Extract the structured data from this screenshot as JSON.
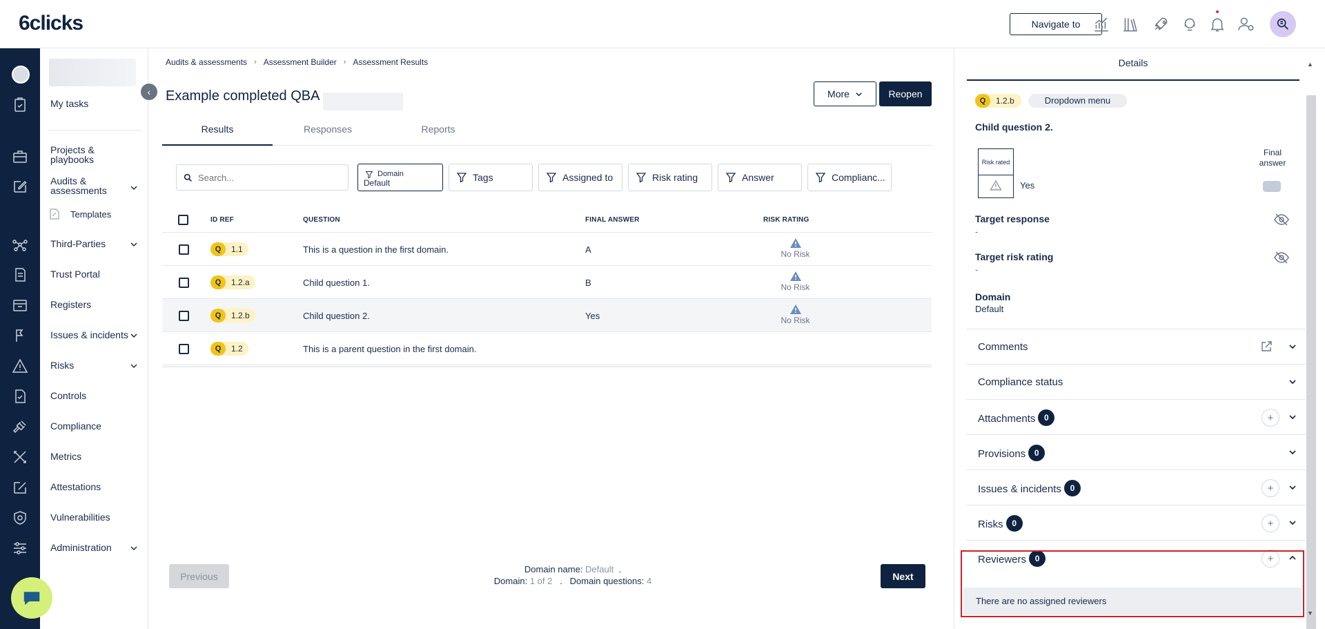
{
  "app": {
    "logo": "6clicks"
  },
  "topbar": {
    "navigate_label": "Navigate to"
  },
  "sidebar": {
    "items": [
      {
        "label": "My tasks"
      },
      {
        "label": "Projects &\nplaybooks"
      },
      {
        "label": "Audits &\nassessments"
      },
      {
        "label": "Templates"
      },
      {
        "label": "Third-Parties"
      },
      {
        "label": "Trust Portal"
      },
      {
        "label": "Registers"
      },
      {
        "label": "Issues & incidents"
      },
      {
        "label": "Risks"
      },
      {
        "label": "Controls"
      },
      {
        "label": "Compliance"
      },
      {
        "label": "Metrics"
      },
      {
        "label": "Attestations"
      },
      {
        "label": "Vulnerabilities"
      },
      {
        "label": "Administration"
      }
    ]
  },
  "breadcrumb": [
    "Audits & assessments",
    "Assessment Builder",
    "Assessment Results"
  ],
  "page": {
    "title": "Example completed QBA",
    "more_label": "More",
    "reopen_label": "Reopen"
  },
  "tabs": [
    "Results",
    "Responses",
    "Reports"
  ],
  "search": {
    "placeholder": "Search..."
  },
  "filters": {
    "domain_key": "Domain",
    "domain_value": "Default",
    "items": [
      "Tags",
      "Assigned to",
      "Risk rating",
      "Answer",
      "Complianc..."
    ]
  },
  "table": {
    "headers": [
      "ID REF",
      "QUESTION",
      "FINAL ANSWER",
      "RISK RATING"
    ],
    "rows": [
      {
        "badge": "Q",
        "id": "1.1",
        "question": "This is a question in the first domain.",
        "answer": "A",
        "risk": "No Risk"
      },
      {
        "badge": "Q",
        "id": "1.2.a",
        "question": "Child question 1.",
        "answer": "B",
        "risk": "No Risk"
      },
      {
        "badge": "Q",
        "id": "1.2.b",
        "question": "Child question 2.",
        "answer": "Yes",
        "risk": "No Risk"
      },
      {
        "badge": "Q",
        "id": "1.2",
        "question": "This is a parent question in the first domain.",
        "answer": "",
        "risk": ""
      }
    ]
  },
  "pagination": {
    "prev_label": "Previous",
    "next_label": "Next",
    "domain_name_label": "Domain name:",
    "domain_name_value": "Default",
    "domain_label": "Domain:",
    "domain_value": "1 of 2",
    "questions_label": "Domain questions:",
    "questions_value": "4",
    "dot": "."
  },
  "details": {
    "title": "Details",
    "badge": "Q",
    "id": "1.2.b",
    "type": "Dropdown menu",
    "question": "Child question 2.",
    "risk_rated_label": "Risk rated",
    "answer_value": "Yes",
    "final_answer_label": "Final answer",
    "target_response_label": "Target response",
    "target_response_value": "-",
    "target_risk_label": "Target risk rating",
    "target_risk_value": "-",
    "domain_label": "Domain",
    "domain_value": "Default",
    "sections": [
      {
        "label": "Comments",
        "count": ""
      },
      {
        "label": "Compliance status",
        "count": ""
      },
      {
        "label": "Attachments",
        "count": "0"
      },
      {
        "label": "Provisions",
        "count": "0"
      },
      {
        "label": "Issues & incidents",
        "count": "0"
      },
      {
        "label": "Risks",
        "count": "0"
      },
      {
        "label": "Reviewers",
        "count": "0"
      }
    ],
    "reviewers_empty": "There are no assigned reviewers"
  }
}
